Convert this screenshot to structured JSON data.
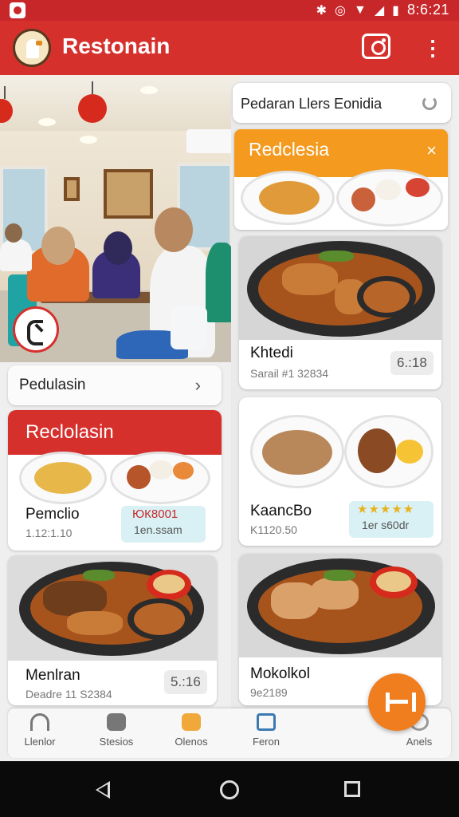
{
  "status_bar": {
    "time": "8:6:21",
    "icons": [
      "app-icon",
      "bluetooth-icon",
      "alarm-icon",
      "wifi-icon",
      "signal-icon",
      "battery-icon"
    ]
  },
  "app_bar": {
    "title": "Restonain",
    "actions": [
      "camera-icon",
      "more-vert-icon"
    ]
  },
  "colors": {
    "primary": "#d6302d",
    "accent": "#f07d1e",
    "promo": "#f39a1f"
  },
  "left_column": {
    "section_header": {
      "label": "Pedulasin",
      "chevron": "›"
    },
    "featured": {
      "banner": "Reclolasin",
      "item_name": "Pemclio",
      "item_sub": "1.12:1.10",
      "rating_top": "ЮК8001",
      "rating_bottom": "1en.ssam"
    },
    "card": {
      "name": "Menlran",
      "sub": "Deadre 11 S2384",
      "price": "5.:16"
    }
  },
  "right_column": {
    "search": {
      "text": "Pedaran Llers Eonidia"
    },
    "promo": {
      "title": "Redclesia",
      "close": "×"
    },
    "cards": [
      {
        "name": "Khtedi",
        "sub": "Sarail #1 32834",
        "price": "6.:18"
      },
      {
        "name": "KaancBo",
        "sub": "K1120.50",
        "rating_stars": "★★★★★",
        "rating_text": "1er s60dr"
      },
      {
        "name": "Mokolkol",
        "sub": "9e2189"
      }
    ]
  },
  "bottom_nav": [
    {
      "label": "Llenlor",
      "icon": "home-icon"
    },
    {
      "label": "Stesios",
      "icon": "pet-icon"
    },
    {
      "label": "Olenos",
      "icon": "food-icon"
    },
    {
      "label": "Feron",
      "icon": "chart-icon"
    },
    {
      "label": "Anels",
      "icon": "profile-icon"
    }
  ]
}
